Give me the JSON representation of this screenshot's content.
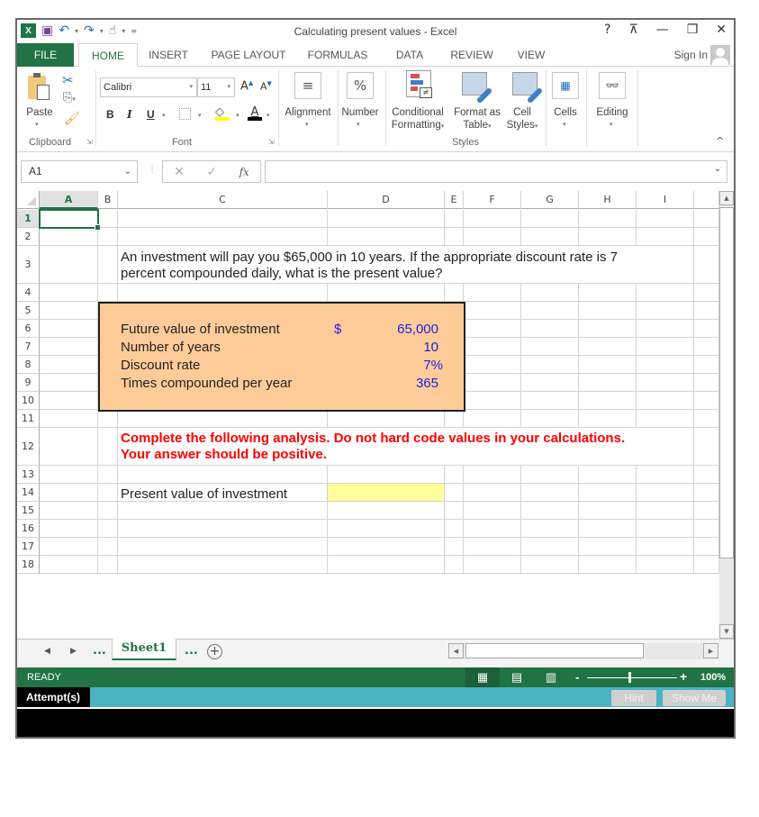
{
  "window": {
    "title": "Calculating present values - Excel",
    "controls": {
      "help": "?",
      "ribbon_display": "⊼",
      "minimize": "—",
      "restore": "❐",
      "close": "✕"
    }
  },
  "quick_access": {
    "logo": "X",
    "icons": [
      "excel-logo-icon",
      "save-icon",
      "undo-icon",
      "redo-icon",
      "touch-mode-icon",
      "customize-icon"
    ]
  },
  "tabs": [
    {
      "label": "FILE",
      "active": false
    },
    {
      "label": "HOME",
      "active": true
    },
    {
      "label": "INSERT",
      "active": false
    },
    {
      "label": "PAGE LAYOUT",
      "active": false
    },
    {
      "label": "FORMULAS",
      "active": false
    },
    {
      "label": "DATA",
      "active": false
    },
    {
      "label": "REVIEW",
      "active": false
    },
    {
      "label": "VIEW",
      "active": false
    }
  ],
  "account": {
    "sign_in": "Sign In"
  },
  "ribbon": {
    "clipboard": {
      "paste": "Paste",
      "group": "Clipboard"
    },
    "font": {
      "name": "Calibri",
      "size": "11",
      "bold": "B",
      "italic": "I",
      "underline": "U",
      "grow": "A",
      "shrink": "A",
      "color": "A",
      "group": "Font"
    },
    "alignment": {
      "label": "Alignment",
      "icon": "≡"
    },
    "number": {
      "label": "Number",
      "icon": "%"
    },
    "styles": {
      "conditional_formatting": [
        "Conditional",
        "Formatting"
      ],
      "format_as_table": [
        "Format as",
        "Table"
      ],
      "cell_styles": [
        "Cell",
        "Styles"
      ],
      "group": "Styles"
    },
    "cells": {
      "label": "Cells"
    },
    "editing": {
      "label": "Editing"
    },
    "collapse": "^"
  },
  "formula_bar": {
    "name_box": "A1",
    "cancel": "✕",
    "enter": "✓",
    "fx": "fx",
    "value": ""
  },
  "sheet": {
    "columns": [
      "A",
      "B",
      "C",
      "D",
      "E",
      "F",
      "G",
      "H",
      "I"
    ],
    "selected_column": "A",
    "rows": [
      "1",
      "2",
      "3",
      "4",
      "5",
      "6",
      "7",
      "8",
      "9",
      "10",
      "11",
      "12",
      "13",
      "14",
      "15",
      "16",
      "17",
      "18"
    ],
    "selected_row": "1",
    "question_line1": "An investment will pay you $65,000 in 10 years. If the appropriate discount rate is 7",
    "question_line2": "percent compounded daily, what is the present value?",
    "inputs": [
      {
        "label": "Future value of investment",
        "currency": "$",
        "value": "65,000"
      },
      {
        "label": "Number of years",
        "currency": "",
        "value": "10"
      },
      {
        "label": "Discount rate",
        "currency": "",
        "value": "7%"
      },
      {
        "label": "Times compounded per year",
        "currency": "",
        "value": "365"
      }
    ],
    "instruction_line1": "Complete the following analysis. Do not hard code values in your calculations.",
    "instruction_line2": "Your answer should be positive.",
    "output_label": "Present value of investment",
    "output_value": "",
    "colors": {
      "input_fill": "#ffcc99",
      "input_value": "#1f1fdc",
      "instruction": "#ff0000",
      "answer_fill": "#ffff99",
      "accent": "#217346"
    }
  },
  "sheet_tabs": {
    "prev": "◀",
    "next": "▶",
    "more_left": "...",
    "active": "Sheet1",
    "more_right": "...",
    "add": "+"
  },
  "status_bar": {
    "status": "READY",
    "views": [
      "normal-view-icon",
      "page-layout-view-icon",
      "page-break-view-icon"
    ],
    "zoom_minus": "-",
    "zoom_plus": "+",
    "zoom": "100%"
  },
  "attempt_bar": {
    "label": "Attempt(s)",
    "hint": "Hint",
    "show_me": "Show Me"
  }
}
